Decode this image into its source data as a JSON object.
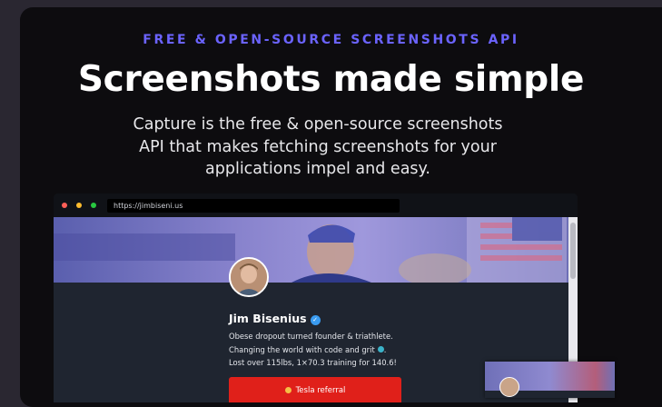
{
  "hero": {
    "eyebrow": "FREE & OPEN-SOURCE SCREENSHOTS API",
    "headline": "Screenshots made simple",
    "subtitle_lines": [
      "Capture is the free & open-source screenshots",
      "API that makes fetching screenshots for your",
      "applications impel and easy."
    ]
  },
  "browser": {
    "url": "https://jimbiseni.us",
    "window_controls": [
      "close",
      "minimize",
      "maximize"
    ]
  },
  "profile": {
    "name": "Jim Bisenius",
    "verified_icon": "verified-badge-icon",
    "bio_lines": [
      "Obese dropout turned founder & triathlete.",
      "Changing the world with code and grit",
      "Lost over 115lbs, 1×70.3 training for 140.6!"
    ],
    "bio_line2_suffix": ".",
    "cta_label": "Tesla referral",
    "cta_icon": "lightning-icon"
  },
  "colors": {
    "accent": "#6b63ff",
    "card_bg": "#0d0c0f",
    "page_bg": "#2a2731",
    "cta_bg": "#e0201a",
    "verified": "#3a9bf0"
  }
}
